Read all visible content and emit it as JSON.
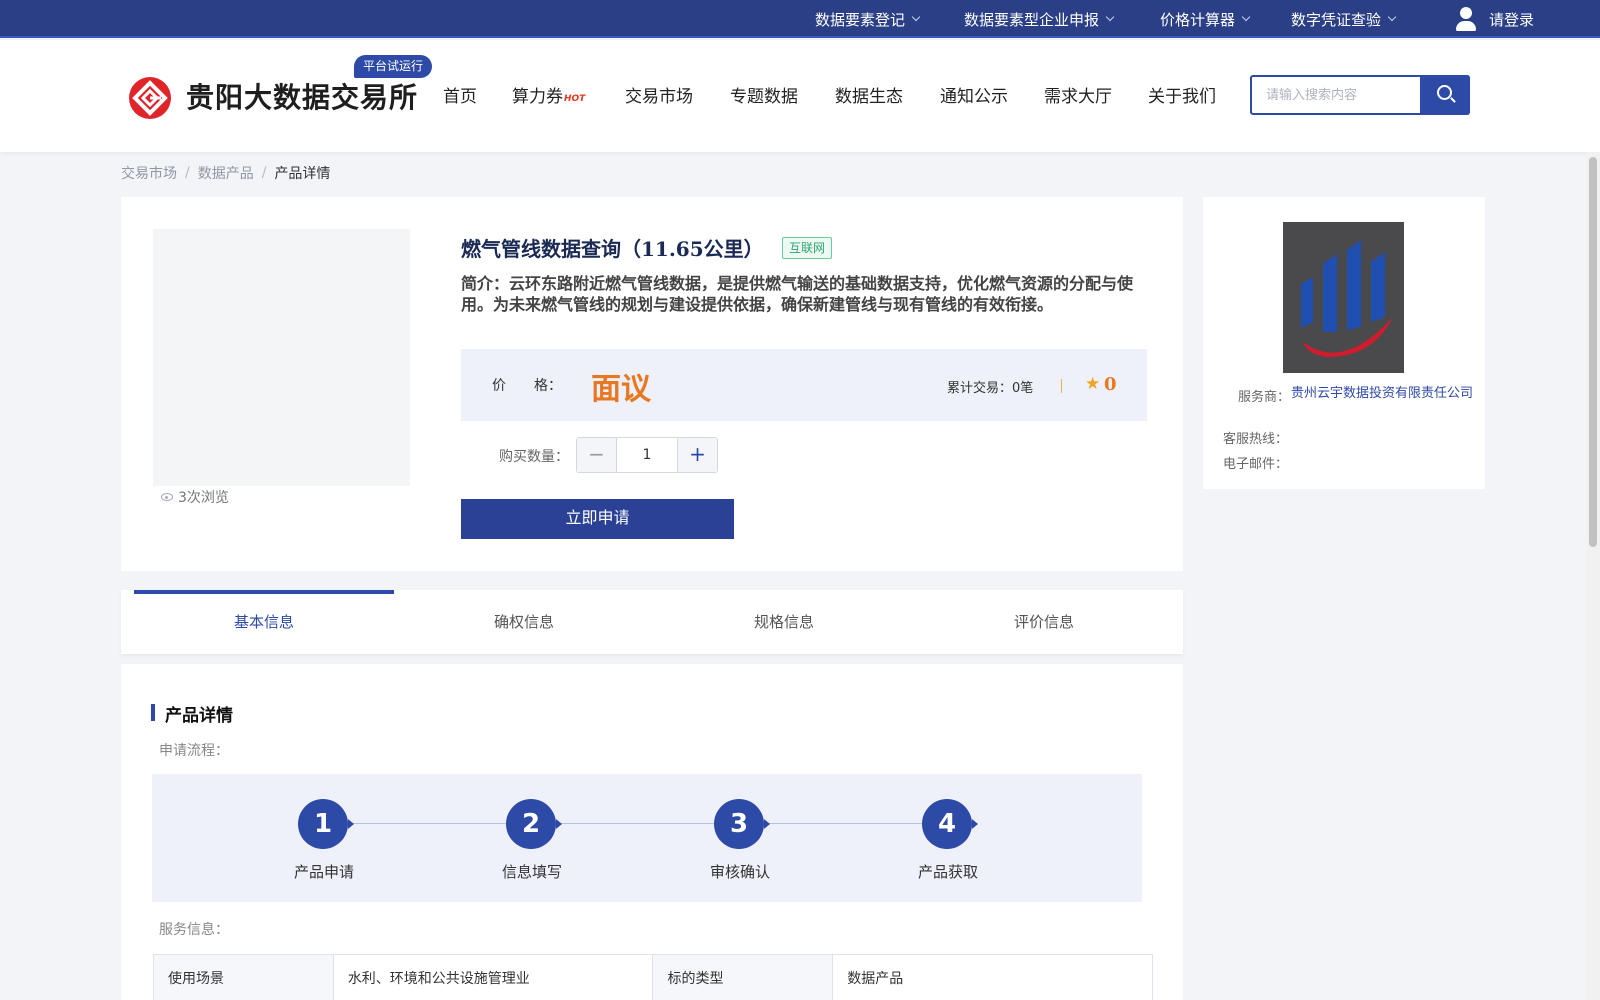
{
  "topbar": {
    "items": [
      {
        "label": "数据要素登记"
      },
      {
        "label": "数据要素型企业申报"
      },
      {
        "label": "价格计算器"
      },
      {
        "label": "数字凭证查验"
      }
    ],
    "login_label": "请登录"
  },
  "header": {
    "brand": "贵阳大数据交易所",
    "trial_badge": "平台试运行",
    "nav": [
      {
        "label": "首页"
      },
      {
        "label": "算力券",
        "badge": "HOT"
      },
      {
        "label": "交易市场"
      },
      {
        "label": "专题数据"
      },
      {
        "label": "数据生态"
      },
      {
        "label": "通知公示"
      },
      {
        "label": "需求大厅"
      },
      {
        "label": "关于我们"
      }
    ],
    "search_placeholder": "请输入搜索内容"
  },
  "breadcrumb": [
    "交易市场",
    "数据产品",
    "产品详情"
  ],
  "breadcrumb_sep": "/",
  "product": {
    "views": "3次浏览",
    "title": "燃气管线数据查询（11.65公里）",
    "tag": "互联网",
    "intro": "简介：云环东路附近燃气管线数据，是提供燃气输送的基础数据支持，优化燃气资源的分配与使用。为未来燃气管线的规划与建设提供依据，确保新建管线与现有管线的有效衔接。",
    "price_label": "价　　格：",
    "price": "面议",
    "trade_label": "累计交易：",
    "trade_count": "0笔",
    "rating": "0",
    "qty_label": "购买数量：",
    "qty": "1",
    "apply_label": "立即申请"
  },
  "seller": {
    "provider_label": "服务商：",
    "provider_name": "贵州云宇数据投资有限责任公司",
    "hotline_label": "客服热线：",
    "hotline": "",
    "email_label": "电子邮件：",
    "email": ""
  },
  "tabs": [
    {
      "label": "基本信息",
      "active": true
    },
    {
      "label": "确权信息"
    },
    {
      "label": "规格信息"
    },
    {
      "label": "评价信息"
    }
  ],
  "detail": {
    "title": "产品详情",
    "process_label": "申请流程：",
    "steps": [
      {
        "num": "1",
        "label": "产品申请"
      },
      {
        "num": "2",
        "label": "信息填写"
      },
      {
        "num": "3",
        "label": "审核确认"
      },
      {
        "num": "4",
        "label": "产品获取"
      }
    ],
    "service_label": "服务信息：",
    "table": [
      [
        "使用场景",
        "水利、环境和公共设施管理业",
        "标的类型",
        "数据产品"
      ]
    ]
  },
  "colors": {
    "primary": "#2d4aa6",
    "topbar": "#2a3f86",
    "price": "#e87722",
    "tag": "#2fa573"
  }
}
